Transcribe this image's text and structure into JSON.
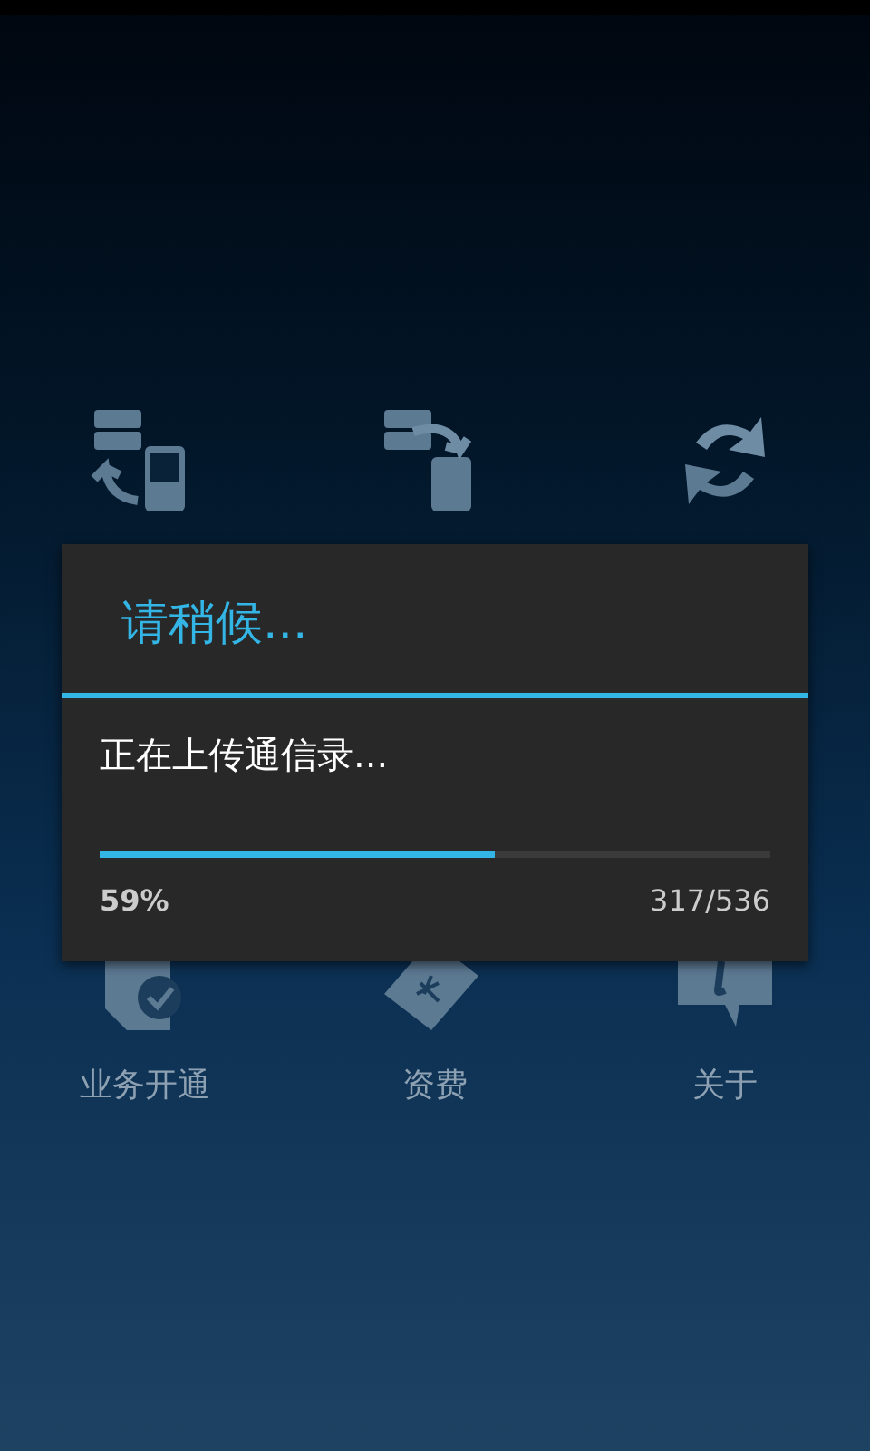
{
  "menu": {
    "labels": [
      "业务开通",
      "资费",
      "关于"
    ]
  },
  "dialog": {
    "title": "请稍候...",
    "message": "正在上传通信录...",
    "level": 0.59,
    "percent": "59%",
    "count": "317/536"
  }
}
